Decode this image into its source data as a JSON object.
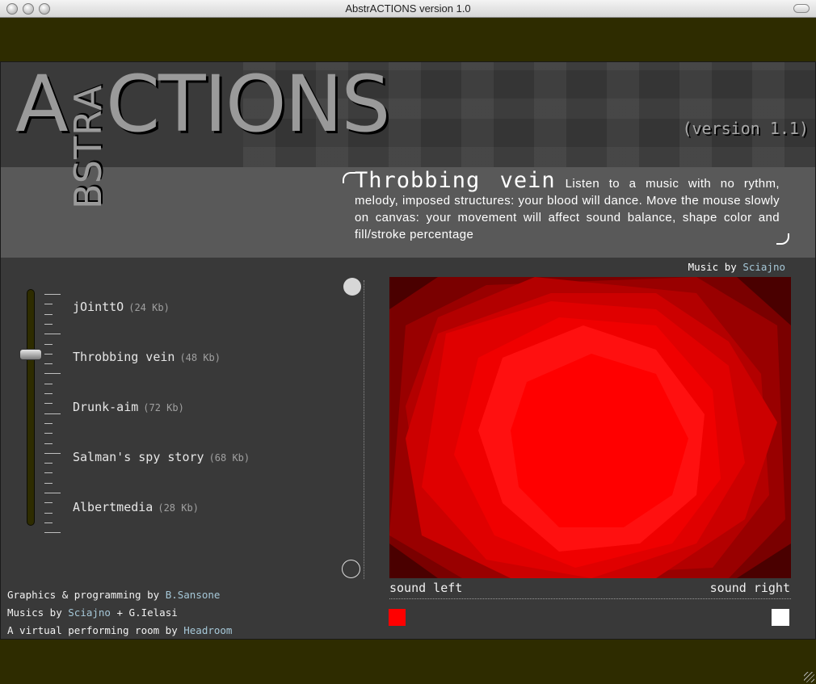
{
  "window": {
    "title": "AbstrACTIONS version 1.0"
  },
  "header": {
    "logo_a": "A",
    "logo_vertical": "BSTRA",
    "logo_rest": "CTIONS",
    "version": "(version 1.1)"
  },
  "description": {
    "title": "Throbbing vein",
    "text": "Listen to a music with no rythm, melody, imposed structures: your blood will dance. Move the mouse slowly on canvas: your movement will affect sound balance, shape color and fill/stroke percentage"
  },
  "music_credit": {
    "prefix": "Music by",
    "author": "Sciajno"
  },
  "tracks": [
    {
      "name": "jOinttO",
      "size": "(24 Kb)"
    },
    {
      "name": "Throbbing vein",
      "size": "(48 Kb)"
    },
    {
      "name": "Drunk-aim",
      "size": "(72 Kb)"
    },
    {
      "name": "Salman's spy story",
      "size": "(68 Kb)"
    },
    {
      "name": "Albertmedia",
      "size": "(28 Kb)"
    }
  ],
  "selected_track": 1,
  "balance": {
    "left_label": "sound left",
    "right_label": "sound right",
    "left_color": "#ff0000",
    "right_color": "#ffffff"
  },
  "credits": {
    "line1_prefix": "Graphics & programming by",
    "line1_name": "B.Sansone",
    "line2_prefix": "Musics by",
    "line2_name1": "Sciajno",
    "line2_sep": "+",
    "line2_name2": "G.Ielasi",
    "line3_prefix": "A virtual performing room by",
    "line3_name": "Headroom"
  },
  "colors": {
    "accent_link": "#a6c8d8",
    "frame_olive": "#2e2c00",
    "panel": "#393939"
  }
}
